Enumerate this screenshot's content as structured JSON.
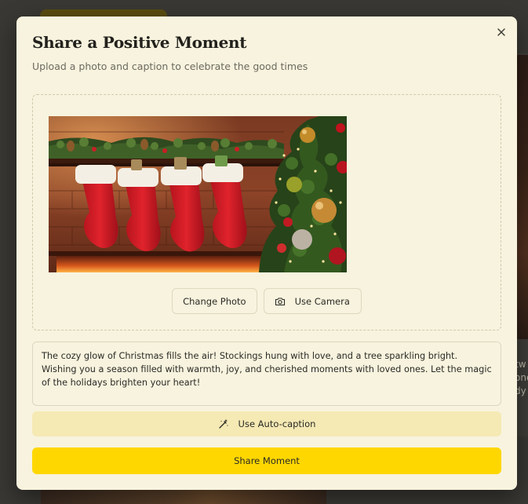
{
  "background": {
    "card_text_lines": [
      "tw",
      "ono",
      "dy"
    ]
  },
  "modal": {
    "title": "Share a Positive Moment",
    "subtitle": "Upload a photo and caption to celebrate the good times",
    "close_icon": "close-icon",
    "photo": {
      "subject": "christmas-stockings-fireplace-tree"
    },
    "buttons": {
      "change_photo": "Change Photo",
      "use_camera": "Use Camera",
      "use_camera_icon": "camera-icon",
      "auto_caption": "Use Auto-caption",
      "auto_caption_icon": "magic-wand-icon",
      "share": "Share Moment"
    },
    "caption": {
      "value": "The cozy glow of Christmas fills the air! Stockings hung with love, and a tree sparkling bright. Wishing you a season filled with warmth, joy, and cherished moments with loved ones. Let the magic of the holidays brighten your heart!"
    }
  },
  "colors": {
    "modal_bg": "#f7f3de",
    "primary": "#ffd700",
    "secondary": "#f5e9b4",
    "overlay": "#3a3834"
  }
}
